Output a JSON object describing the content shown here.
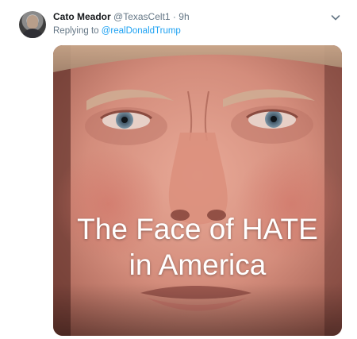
{
  "tweet": {
    "author_name": "Cato Meador",
    "author_handle": "@TexasCelt1",
    "separator": "·",
    "time": "9h",
    "replying_prefix": "Replying to ",
    "replying_to": "@realDonaldTrump",
    "image": {
      "caption_line1": "The Face of HATE",
      "caption_line2": "in America"
    }
  },
  "icons": {
    "avatar": "user-avatar",
    "menu": "chevron-down-icon"
  },
  "colors": {
    "primary_text": "#14171a",
    "secondary_text": "#657786",
    "link": "#1da1f2"
  }
}
